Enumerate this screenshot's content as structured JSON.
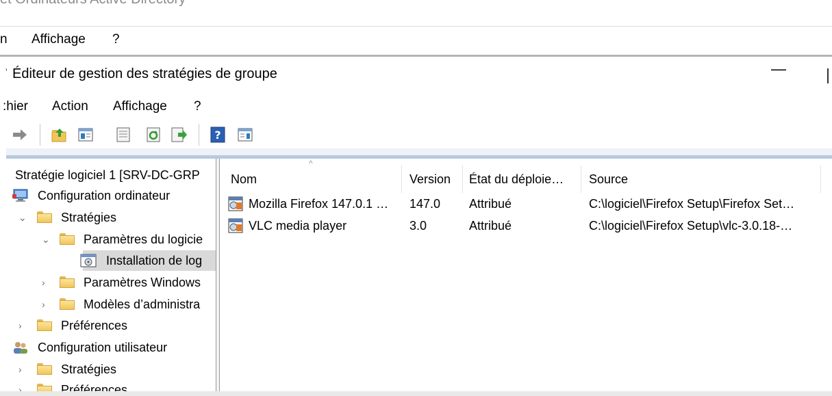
{
  "background_window": {
    "title": "et Ordinateurs Active Directory",
    "menu": [
      "n",
      "Affichage",
      "?"
    ]
  },
  "window": {
    "tick": "'",
    "title": "Éditeur de gestion des stratégies de groupe",
    "minimize_glyph": "—"
  },
  "menu": [
    ":hier",
    "Action",
    "Affichage",
    "?"
  ],
  "toolbar": {
    "icons": [
      "forward-arrow-icon",
      "up-folder-icon",
      "show-hide-tree-icon",
      "properties-icon",
      "refresh-icon",
      "export-list-icon",
      "help-icon",
      "show-hide-action-pane-icon"
    ]
  },
  "tree": {
    "root_tick": "'",
    "items": [
      {
        "label": "Stratégie logiciel 1 [SRV-DC-GRP"
      },
      {
        "label": "Configuration ordinateur"
      },
      {
        "label": "Stratégies",
        "chevron": "⌄"
      },
      {
        "label": "Paramètres du logicie",
        "chevron": "⌄"
      },
      {
        "label": "Installation de log"
      },
      {
        "label": "Paramètres Windows",
        "chevron": "›"
      },
      {
        "label": "Modèles d’administra",
        "chevron": "›"
      },
      {
        "label": "Préférences",
        "chevron": "›"
      },
      {
        "label": "Configuration utilisateur"
      },
      {
        "label": "Stratégies",
        "chevron": "›"
      },
      {
        "label": "Préférences",
        "chevron": "›"
      }
    ]
  },
  "list": {
    "sort_caret": "^",
    "columns": [
      "Nom",
      "Version",
      "État du déploie…",
      "Source"
    ],
    "rows": [
      {
        "name": "Mozilla Firefox 147.0.1 …",
        "version": "147.0",
        "state": "Attribué",
        "source": "C:\\logiciel\\Firefox Setup\\Firefox Set…"
      },
      {
        "name": "VLC media player",
        "version": "3.0",
        "state": "Attribué",
        "source": "C:\\logiciel\\Firefox Setup\\vlc-3.0.18-…"
      }
    ]
  },
  "colors": {
    "selection": "#d9d9d9",
    "panel_accent": "#b7c9e0",
    "folder": "#f0c65b"
  }
}
